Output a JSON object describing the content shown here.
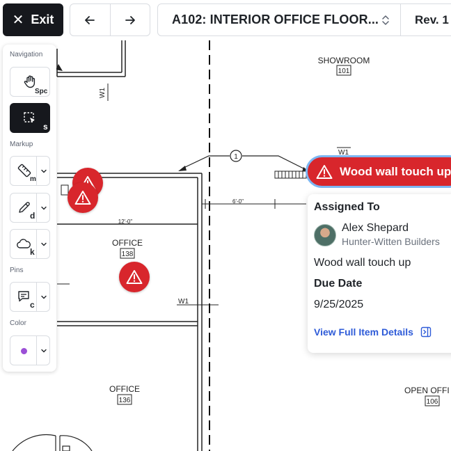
{
  "topbar": {
    "exit_label": "Exit",
    "sheet_title": "A102: INTERIOR OFFICE FLOOR...",
    "revision": "Rev. 1"
  },
  "toolbar": {
    "navigation_label": "Navigation",
    "markup_label": "Markup",
    "pins_label": "Pins",
    "color_label": "Color",
    "tools": {
      "pan_shortcut": "Spc",
      "select_shortcut": "s",
      "measure_shortcut": "m",
      "draw_shortcut": "d",
      "cloud_shortcut": "k",
      "comment_shortcut": "c"
    },
    "selected_color": "#9b4fd6"
  },
  "plan": {
    "rooms": [
      {
        "name": "SHOWROOM",
        "number": "101"
      },
      {
        "name": "OFFICE",
        "number": "138"
      },
      {
        "name": "OFFICE",
        "number": "136"
      },
      {
        "name": "OPEN OFFI",
        "number": "106"
      }
    ],
    "dimensions": {
      "dim_12": "12'-0\"",
      "dim_6": "6'-0\""
    },
    "grid_marker": "1",
    "wall_tags": {
      "w1_a": "W1",
      "w1_b": "W1",
      "w1_c": "W1"
    }
  },
  "pin_colors": {
    "issue": "#d8262c",
    "selection_ring": "#7cb6f2"
  },
  "callout": {
    "title": "Wood wall touch up",
    "assigned_to_label": "Assigned To",
    "assignee_name": "Alex Shepard",
    "assignee_company": "Hunter-Witten Builders",
    "description": "Wood wall touch up",
    "due_date_label": "Due Date",
    "due_date": "9/25/2025",
    "details_link": "View Full Item Details"
  }
}
